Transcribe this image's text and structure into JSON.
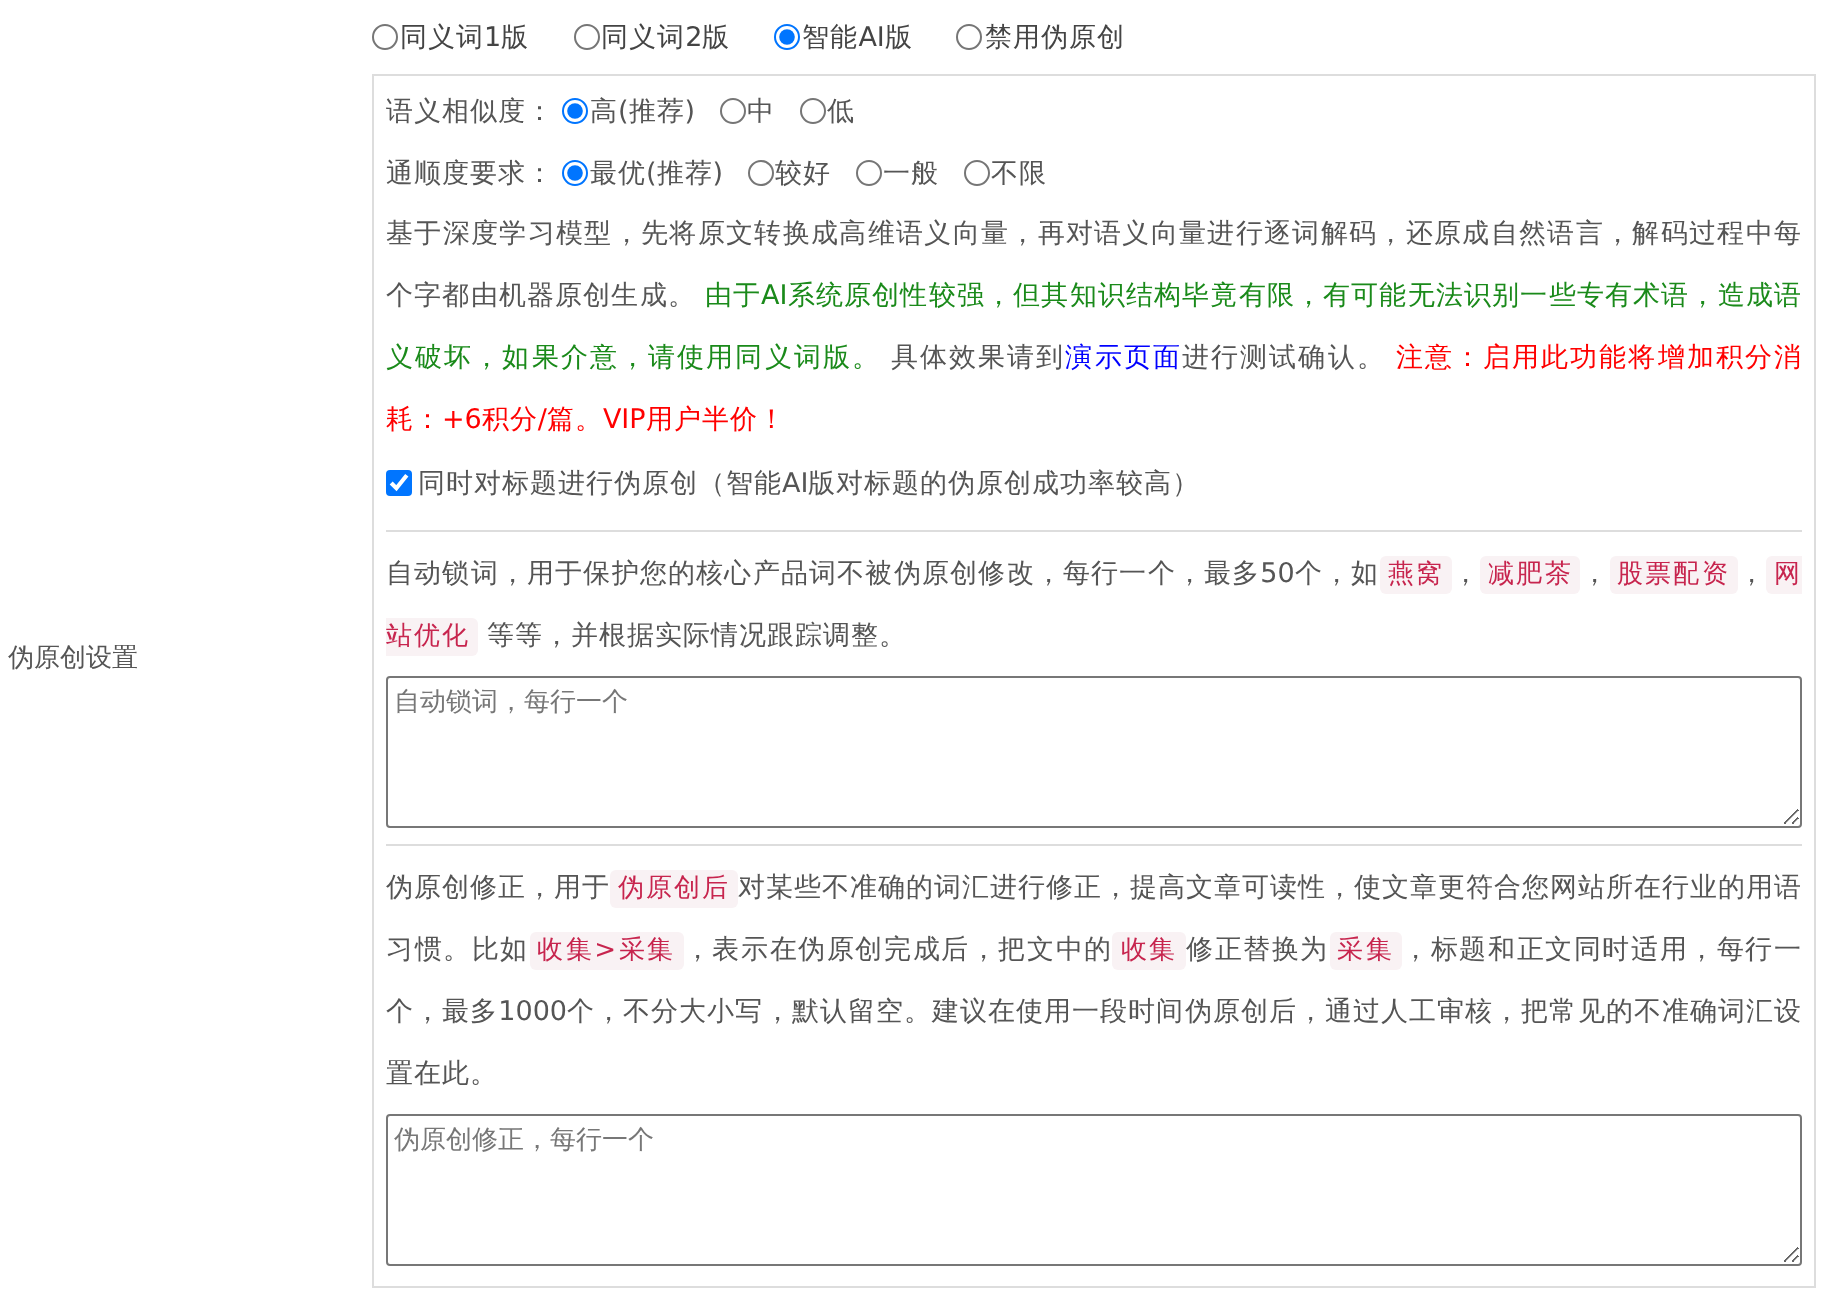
{
  "section_label": "伪原创设置",
  "mode_options": [
    {
      "label": "同义词1版",
      "selected": false
    },
    {
      "label": "同义词2版",
      "selected": false
    },
    {
      "label": "智能AI版",
      "selected": true
    },
    {
      "label": "禁用伪原创",
      "selected": false
    }
  ],
  "similarity": {
    "label": "语义相似度：",
    "options": [
      {
        "label": "高(推荐)",
        "selected": true
      },
      {
        "label": "中",
        "selected": false
      },
      {
        "label": "低",
        "selected": false
      }
    ]
  },
  "fluency": {
    "label": "通顺度要求：",
    "options": [
      {
        "label": "最优(推荐)",
        "selected": true
      },
      {
        "label": "较好",
        "selected": false
      },
      {
        "label": "一般",
        "selected": false
      },
      {
        "label": "不限",
        "selected": false
      }
    ]
  },
  "ai_description": [
    {
      "kind": "plain",
      "text": "基于深度学习模型，先将原文转换成高维语义向量，再对语义向量进行逐词解码，还原成自然语言，解码过程中每个字都由机器原创生成。 "
    },
    {
      "kind": "note",
      "text": "由于AI系统原创性较强，但其知识结构毕竟有限，有可能无法识别一些专有术语，造成语义破坏，如果介意，请使用同义词版。"
    },
    {
      "kind": "plain",
      "text": " 具体效果请到"
    },
    {
      "kind": "link",
      "text": "演示页面"
    },
    {
      "kind": "plain",
      "text": "进行测试确认。 "
    },
    {
      "kind": "warning",
      "text": "注意：启用此功能将增加积分消耗：+6积分/篇。VIP用户半价！"
    }
  ],
  "title_option": {
    "label": "同时对标题进行伪原创（智能AI版对标题的伪原创成功率较高）",
    "checked": true
  },
  "lock_words": {
    "description": [
      {
        "kind": "plain",
        "text": "自动锁词，用于保护您的核心产品词不被伪原创修改，每行一个，最多50个，如"
      },
      {
        "kind": "tag",
        "text": "燕窝"
      },
      {
        "kind": "plain",
        "text": "，"
      },
      {
        "kind": "tag",
        "text": "减肥茶"
      },
      {
        "kind": "plain",
        "text": "，"
      },
      {
        "kind": "tag",
        "text": "股票配资"
      },
      {
        "kind": "plain",
        "text": "，"
      },
      {
        "kind": "tag",
        "text": "网站优化"
      },
      {
        "kind": "plain",
        "text": " 等等，并根据实际情况跟踪调整。"
      }
    ],
    "placeholder": "自动锁词，每行一个"
  },
  "correction": {
    "description": [
      {
        "kind": "plain",
        "text": "伪原创修正，用于"
      },
      {
        "kind": "tag",
        "text": "伪原创后"
      },
      {
        "kind": "plain",
        "text": "对某些不准确的词汇进行修正，提高文章可读性，使文章更符合您网站所在行业的用语习惯。比如"
      },
      {
        "kind": "tag",
        "text": "收集>采集"
      },
      {
        "kind": "plain",
        "text": "，表示在伪原创完成后，把文中的"
      },
      {
        "kind": "tag",
        "text": "收集"
      },
      {
        "kind": "plain",
        "text": "修正替换为"
      },
      {
        "kind": "tag",
        "text": "采集"
      },
      {
        "kind": "plain",
        "text": "，标题和正文同时适用，每行一个，最多1000个，不分大小写，默认留空。建议在使用一段时间伪原创后，通过人工审核，把常见的不准确词汇设置在此。"
      }
    ],
    "placeholder": "伪原创修正，每行一个"
  }
}
